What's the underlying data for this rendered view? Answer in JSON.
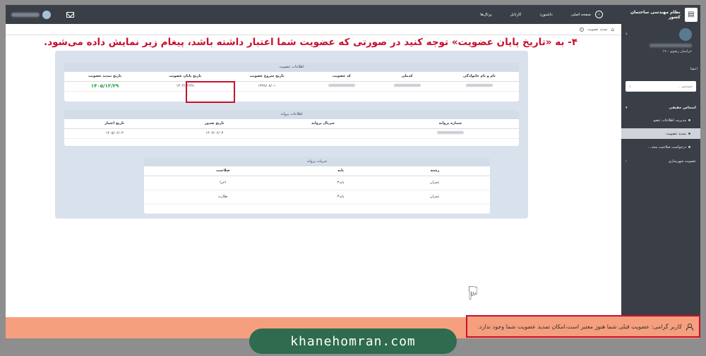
{
  "topbar": {
    "brand_title": "نظام مهندسی ساختمان کشور",
    "nav": [
      "صفحه اصلی",
      "داشبورد",
      "کارتابل",
      "پرتال‌ها"
    ]
  },
  "breadcrumb": {
    "current": "تمدید عضویت"
  },
  "instruction": "۴- به «تاریخ پایان عضویت» توجه کنید در صورتی که عضویت شما اعتبار داشته باشد، پیغام زیر نمایش داده می‌شود.",
  "sidebar": {
    "location": "خراسان رضوی - ۱۹",
    "section_label": "اعضا",
    "search_placeholder": "جستجو ...",
    "items": [
      {
        "label": "اشخاص حقیقی"
      },
      {
        "label": "مدیریت اطلاعات عضو"
      },
      {
        "label": "تمدید عضویت"
      },
      {
        "label": "درخواست صلاحیت مجد..."
      },
      {
        "label": "عضویت شهرسازی"
      }
    ]
  },
  "membership": {
    "title": "اطلاعات عضویت",
    "headers": [
      "نام و نام خانوادگی",
      "کدملی",
      "کد عضویت",
      "تاریخ شروع عضویت",
      "تاریخ پایان عضویت",
      "تاریخ تمدید عضویت"
    ],
    "row": {
      "start": "۱۳۹۹/۰۸/۰۱",
      "end": "۱۴۰۴/۱۲/۲۹",
      "renew": "۱۴۰۵/۱۲/۲۹"
    }
  },
  "license": {
    "title": "اطلاعات پروانه",
    "headers": [
      "شماره پروانه",
      "سریال پروانه",
      "تاریخ صدور",
      "تاریخ اعتبار"
    ],
    "row": {
      "issue": "۱۴۰۲/۰۶/۰۳",
      "valid": "۱۴۰۵/۰۶/۰۳"
    }
  },
  "license_details": {
    "title": "جزییات پروانه",
    "headers": [
      "رشته",
      "پایه",
      "صلاحیت"
    ],
    "rows": [
      {
        "field": "عمران",
        "grade": "پایه۳",
        "competency": "اجرا"
      },
      {
        "field": "عمران",
        "grade": "پایه۳",
        "competency": "نظارت"
      }
    ]
  },
  "alert": {
    "message": "کاربر گرامی: عضویت قبلی شما هنوز معتبر است،امکان تمدید عضویت شما وجود ندارد."
  },
  "watermark": "khanehomran.com",
  "colors": {
    "accent_red": "#c8102e",
    "alert_bg": "#f59f7e",
    "renew_green": "#1a9a3a",
    "topbar": "#3a3f47"
  }
}
